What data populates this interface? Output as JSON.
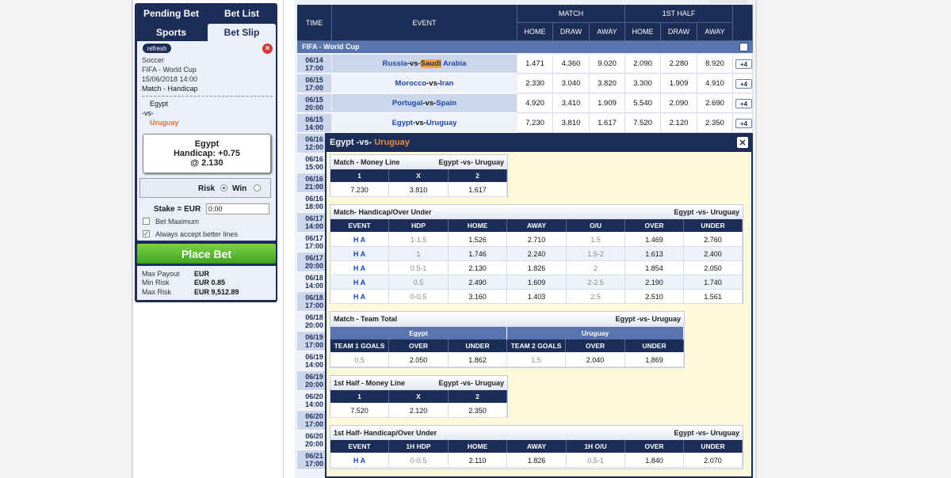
{
  "left_panel": {
    "tabs": {
      "pending_bet": "Pending Bet",
      "bet_list": "Bet List",
      "sports": "Sports",
      "bet_slip": "Bet Slip"
    },
    "refresh": "refresh",
    "slip": {
      "sport": "Soccer",
      "league": "FIFA - World Cup",
      "datetime": "15/06/2018 14:00",
      "market": "Match - Handicap",
      "home": "Egypt",
      "vs": "-vs-",
      "away": "Uruguay",
      "selection": "Egypt",
      "handicap": "Handicap: +0.75",
      "price": "@ 2.130"
    },
    "risk_label": "Risk",
    "win_label": "Win",
    "stake_label": "Stake = EUR",
    "stake_value": "0.00",
    "bet_maximum": "Bet Maximum",
    "always_accept": "Always accept better lines",
    "place_bet": "Place Bet",
    "max_payout_label": "Max Payout",
    "max_payout_value": "EUR",
    "min_risk_label": "Min Risk",
    "min_risk_value": "EUR 0.85",
    "max_risk_label": "Max Risk",
    "max_risk_value": "EUR 9,512.89"
  },
  "odds_table": {
    "headers": {
      "time": "TIME",
      "event": "EVENT",
      "match": "MATCH",
      "first_half": "1ST HALF",
      "home": "HOME",
      "draw": "DRAW",
      "away": "AWAY"
    },
    "league": "FIFA - World Cup",
    "rows": [
      {
        "date": "06/14",
        "time": "17:00",
        "home": "Russia",
        "away_a": "Saudi",
        "away_b": " Arabia",
        "odds": [
          "1.471",
          "4.360",
          "9.020",
          "2.090",
          "2.280",
          "8.920"
        ],
        "more": "+4"
      },
      {
        "date": "06/15",
        "time": "17:00",
        "home": "Morocco",
        "away_a": "Iran",
        "away_b": "",
        "odds": [
          "2.330",
          "3.040",
          "3.820",
          "3.300",
          "1.909",
          "4.910"
        ],
        "more": "+4"
      },
      {
        "date": "06/15",
        "time": "20:00",
        "home": "Portugal",
        "away_a": "Spain",
        "away_b": "",
        "odds": [
          "4.920",
          "3.410",
          "1.909",
          "5.540",
          "2.090",
          "2.690"
        ],
        "more": "+4"
      },
      {
        "date": "06/15",
        "time": "14:00",
        "home": "Egypt",
        "away_a": "Uruguay",
        "away_b": "",
        "odds": [
          "7.230",
          "3.810",
          "1.617",
          "7.520",
          "2.120",
          "2.350"
        ],
        "more": "+4"
      }
    ],
    "vs": "-vs-",
    "hidden_rows": [
      {
        "date": "06/16",
        "time": "12:00"
      },
      {
        "date": "06/16",
        "time": "15:00"
      },
      {
        "date": "06/16",
        "time": "21:00"
      },
      {
        "date": "06/16",
        "time": "18:00"
      },
      {
        "date": "06/17",
        "time": "14:00"
      },
      {
        "date": "06/17",
        "time": "17:00"
      },
      {
        "date": "06/17",
        "time": "20:00"
      },
      {
        "date": "06/18",
        "time": "14:00"
      },
      {
        "date": "06/18",
        "time": "17:00"
      },
      {
        "date": "06/18",
        "time": "20:00"
      },
      {
        "date": "06/19",
        "time": "17:00"
      },
      {
        "date": "06/19",
        "time": "14:00"
      },
      {
        "date": "06/19",
        "time": "20:00"
      },
      {
        "date": "06/20",
        "time": "14:00"
      },
      {
        "date": "06/20",
        "time": "17:00"
      },
      {
        "date": "06/20",
        "time": "20:00"
      },
      {
        "date": "06/21",
        "time": "17:00"
      }
    ]
  },
  "popup": {
    "title_home": "Egypt",
    "title_vs": " -vs- ",
    "title_away": "Uruguay",
    "close": "✕",
    "match_label": "Egypt -vs- Uruguay",
    "money_line": {
      "title": "Match - Money Line",
      "headers": [
        "1",
        "X",
        "2"
      ],
      "values": [
        "7.230",
        "3.810",
        "1.617"
      ]
    },
    "handicap": {
      "title": "Match- Handicap/Over Under",
      "headers": [
        "EVENT",
        "HDP",
        "HOME",
        "AWAY",
        "O/U",
        "OVER",
        "UNDER"
      ],
      "rows": [
        [
          "H A",
          "1-1.5",
          "1.526",
          "2.710",
          "1.5",
          "1.469",
          "2.760"
        ],
        [
          "H A",
          "1",
          "1.746",
          "2.240",
          "1.5-2",
          "1.613",
          "2.400"
        ],
        [
          "H A",
          "0.5-1",
          "2.130",
          "1.826",
          "2",
          "1.854",
          "2.050"
        ],
        [
          "H A",
          "0.5",
          "2.490",
          "1.609",
          "2-2.5",
          "2.190",
          "1.740"
        ],
        [
          "H A",
          "0-0.5",
          "3.160",
          "1.403",
          "2.5",
          "2.510",
          "1.561"
        ]
      ]
    },
    "team_total": {
      "title": "Match - Team Total",
      "team1": "Egypt",
      "team2": "Uruguay",
      "headers": [
        "TEAM 1 GOALS",
        "OVER",
        "UNDER",
        "TEAM 2 GOALS",
        "OVER",
        "UNDER"
      ],
      "values": [
        "0.5",
        "2.050",
        "1.862",
        "1.5",
        "2.040",
        "1.869"
      ]
    },
    "half_money_line": {
      "title": "1st Half - Money Line",
      "headers": [
        "1",
        "X",
        "2"
      ],
      "values": [
        "7.520",
        "2.120",
        "2.350"
      ]
    },
    "half_handicap": {
      "title": "1st Half- Handicap/Over Under",
      "headers": [
        "EVENT",
        "1H HDP",
        "HOME",
        "AWAY",
        "1H O/U",
        "OVER",
        "UNDER"
      ],
      "values": [
        "H A",
        "0-0.5",
        "2.110",
        "1.826",
        "0.5-1",
        "1.840",
        "2.070"
      ]
    }
  }
}
